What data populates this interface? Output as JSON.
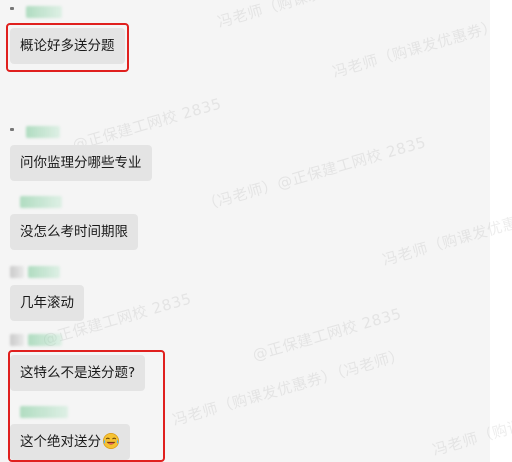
{
  "messages": [
    {
      "id": "m1",
      "text": "概论好多送分题",
      "highlighted": true
    },
    {
      "id": "m2",
      "text": "问你监理分哪些专业",
      "highlighted": false
    },
    {
      "id": "m3",
      "text": "没怎么考时间期限",
      "highlighted": false
    },
    {
      "id": "m4",
      "text": "几年滚动",
      "highlighted": false
    },
    {
      "id": "m5",
      "text": "这特么不是送分题?",
      "highlighted": true
    },
    {
      "id": "m6",
      "text": "这个绝对送分",
      "emoji": "laughing-tears-emoji",
      "highlighted": true
    }
  ],
  "watermark": {
    "line_a": "冯老师（购课发优惠券）",
    "line_b": "@正保建工网校 2835",
    "line_c": "（冯老师）@正保建工网校 2835",
    "line_d": "冯老师（购课发优惠券）（冯老师）",
    "line_e": "@正保建工网校 2835",
    "line_f": "冯老师（购课发优惠券）（冯老师）@正保建工网校",
    "line_g": "冯老师（购课发优惠券）"
  },
  "colors": {
    "bubble_bg": "#e4e4e4",
    "highlight_border": "#e0201e",
    "background": "#f5f5f5"
  }
}
